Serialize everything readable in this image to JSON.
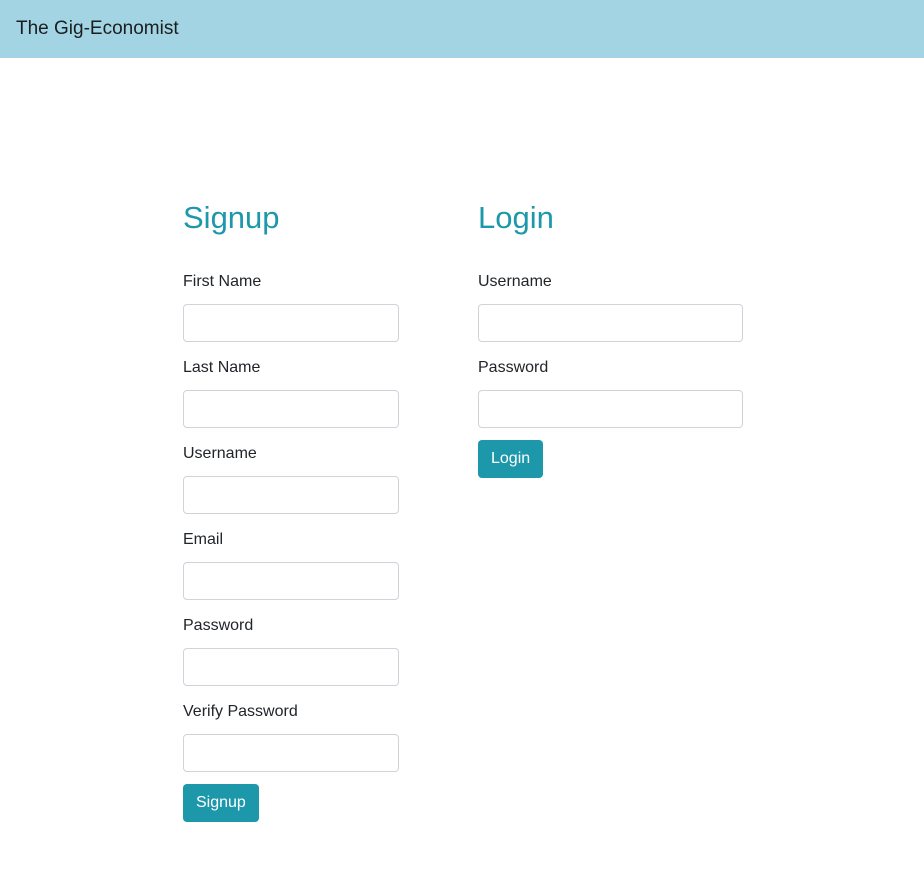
{
  "navbar": {
    "brand": "The Gig-Economist",
    "background": "#a3d4e3"
  },
  "accent_color": "#1c98aa",
  "signup": {
    "heading": "Signup",
    "fields": [
      {
        "label": "First Name",
        "value": "",
        "placeholder": ""
      },
      {
        "label": "Last Name",
        "value": "",
        "placeholder": ""
      },
      {
        "label": "Username",
        "value": "",
        "placeholder": ""
      },
      {
        "label": "Email",
        "value": "",
        "placeholder": ""
      },
      {
        "label": "Password",
        "value": "",
        "placeholder": ""
      },
      {
        "label": "Verify Password",
        "value": "",
        "placeholder": ""
      }
    ],
    "button_label": "Signup"
  },
  "login": {
    "heading": "Login",
    "fields": [
      {
        "label": "Username",
        "value": "",
        "placeholder": ""
      },
      {
        "label": "Password",
        "value": "",
        "placeholder": ""
      }
    ],
    "button_label": "Login"
  }
}
